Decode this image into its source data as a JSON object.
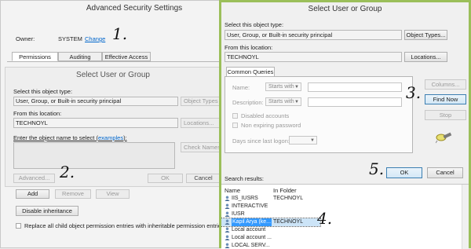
{
  "adv": {
    "title": "Advanced Security Settings",
    "owner_label": "Owner:",
    "owner_value": "SYSTEM",
    "change_link": "Change",
    "tabs": [
      "Permissions",
      "Auditing",
      "Effective Access"
    ],
    "add": "Add",
    "remove": "Remove",
    "view": "View",
    "disable_inheritance": "Disable inheritance",
    "replace_label": "Replace all child object permission entries with inheritable permission entries"
  },
  "small": {
    "title": "Select User or Group",
    "object_type_label": "Select this object type:",
    "object_type_value": "User, Group, or Built-in security principal",
    "object_types_btn": "Object Types",
    "location_label": "From this location:",
    "location_value": "TECHNOYL",
    "locations_btn": "Locations...",
    "enter_label_prefix": "Enter the object name to select (",
    "examples_link": "examples",
    "enter_label_suffix": "):",
    "check_names_btn": "Check Names",
    "advanced_btn": "Advanced...",
    "ok_btn": "OK",
    "cancel_btn": "Cancel"
  },
  "big": {
    "title": "Select User or Group",
    "object_type_label": "Select this object type:",
    "object_type_value": "User, Group, or Built-in security principal",
    "object_types_btn": "Object Types...",
    "location_label": "From this location:",
    "location_value": "TECHNOYL",
    "locations_btn": "Locations...",
    "tab": "Common Queries",
    "name_label": "Name:",
    "desc_label": "Description:",
    "starts_with": "Starts with",
    "disabled_accounts": "Disabled accounts",
    "non_expiring": "Non expiring password",
    "days_label": "Days since last logon:",
    "columns_btn": "Columns...",
    "find_now_btn": "Find Now",
    "stop_btn": "Stop",
    "search_results": "Search results:",
    "ok_btn": "OK",
    "cancel_btn": "Cancel",
    "col_name": "Name",
    "col_folder": "In Folder",
    "rows": [
      {
        "name": "IIS_IUSRS",
        "folder": "TECHNOYL"
      },
      {
        "name": "INTERACTIVE",
        "folder": ""
      },
      {
        "name": "IUSR",
        "folder": ""
      },
      {
        "name": "Kapil Arya (ke...",
        "folder": "TECHNOYL"
      },
      {
        "name": "Local account",
        "folder": ""
      },
      {
        "name": "Local account ...",
        "folder": ""
      },
      {
        "name": "LOCAL SERV...",
        "folder": ""
      }
    ]
  },
  "annotations": [
    "1.",
    "2.",
    "3.",
    "4.",
    "5."
  ],
  "colors": {
    "accent": "#9bbf5a",
    "selection": "#cce4f7",
    "link": "#0066cc"
  }
}
